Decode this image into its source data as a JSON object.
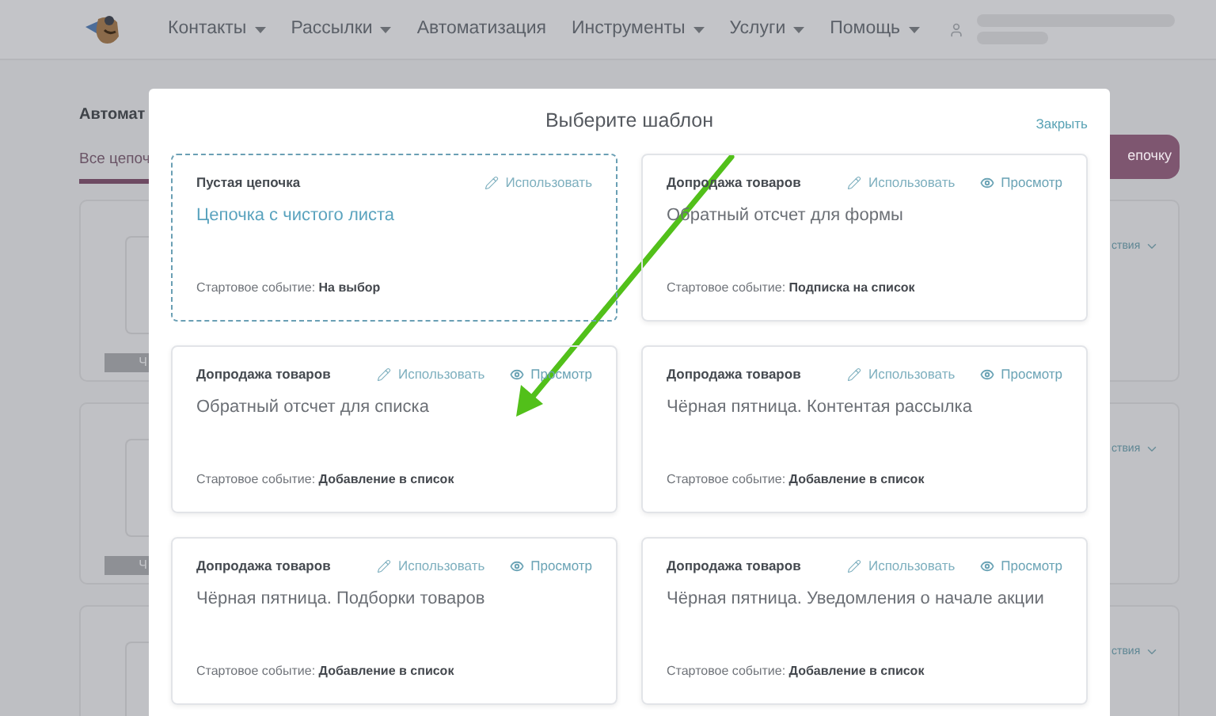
{
  "nav": {
    "items": [
      {
        "label": "Контакты",
        "dropdown": true
      },
      {
        "label": "Рассылки",
        "dropdown": true
      },
      {
        "label": "Автоматизация",
        "dropdown": false
      },
      {
        "label": "Инструменты",
        "dropdown": true
      },
      {
        "label": "Услуги",
        "dropdown": true
      },
      {
        "label": "Помощь",
        "dropdown": true
      }
    ]
  },
  "page": {
    "heading": "Автомат",
    "tabs": [
      {
        "label": "Все цепоч",
        "selected": true
      }
    ],
    "create_button": "епочку",
    "chains": [
      {
        "tag": "Ч",
        "actions": "ствия"
      },
      {
        "tag": "Ч",
        "actions": "ствия"
      },
      {
        "actions": "ствия"
      }
    ]
  },
  "modal": {
    "title": "Выберите шаблон",
    "close": "Закрыть",
    "templates": [
      {
        "kind": "blank",
        "category": "Пустая цепочка",
        "use": "Использовать",
        "name": "Цепочка с чистого листа",
        "start_event": "Стартовое событие: **На выбор**"
      },
      {
        "kind": "template",
        "category": "Допродажа товаров",
        "use": "Использовать",
        "preview": "Просмотр",
        "name": "Обратный отсчет для формы",
        "start_event": "Стартовое событие: **Подписка на список**"
      },
      {
        "kind": "template",
        "category": "Допродажа товаров",
        "use": "Использовать",
        "preview": "Просмотр",
        "name": "Обратный отсчет для списка",
        "start_event": "Стартовое событие: **Добавление в список**"
      },
      {
        "kind": "template",
        "category": "Допродажа товаров",
        "use": "Использовать",
        "preview": "Просмотр",
        "name": "Чёрная пятница. Контентая рассылка",
        "start_event": "Стартовое событие: **Добавление в список**"
      },
      {
        "kind": "template",
        "category": "Допродажа товаров",
        "use": "Использовать",
        "preview": "Просмотр",
        "name": "Чёрная пятница. Подборки товаров",
        "start_event": "Стартовое событие: **Добавление в список**"
      },
      {
        "kind": "template",
        "category": "Допродажа товаров",
        "use": "Использовать",
        "preview": "Просмотр",
        "name": "Чёрная пятница. Уведомления о начале акции",
        "start_event": "Стартовое событие: **Добавление в список**"
      }
    ]
  }
}
